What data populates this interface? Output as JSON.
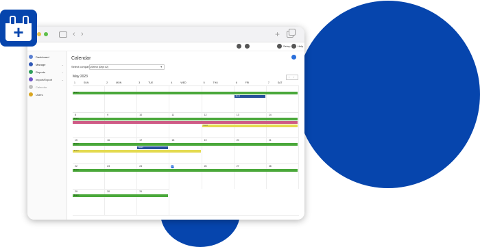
{
  "page": {
    "title": "Calendar",
    "select_label": "Select company",
    "select_value": "Select (Dept #2)",
    "month_label": "May 2023"
  },
  "topbar": {
    "setup_label": "Setup",
    "help_label": "Help"
  },
  "sidebar": {
    "items": [
      {
        "label": "Dashboard",
        "icon": "dashboard-icon",
        "color": "#5a7fd1",
        "has_chevron": false,
        "active": false
      },
      {
        "label": "Manage",
        "icon": "manage-icon",
        "color": "#2f58b6",
        "has_chevron": true,
        "active": false
      },
      {
        "label": "Reports",
        "icon": "reports-icon",
        "color": "#2e9f5a",
        "has_chevron": true,
        "active": false
      },
      {
        "label": "Import/Export",
        "icon": "import-export-icon",
        "color": "#6d53c7",
        "has_chevron": true,
        "active": false
      },
      {
        "label": "Calendar",
        "icon": "calendar-icon",
        "color": "#bfbfbf",
        "has_chevron": false,
        "active": true
      },
      {
        "label": "Users",
        "icon": "users-icon",
        "color": "#d9a520",
        "has_chevron": false,
        "active": false
      }
    ]
  },
  "weekdays": [
    {
      "num": "1",
      "name": "SUN"
    },
    {
      "num": "2",
      "name": "MON"
    },
    {
      "num": "3",
      "name": "TUE"
    },
    {
      "num": "4",
      "name": "WED"
    },
    {
      "num": "5",
      "name": "THU"
    },
    {
      "num": "6",
      "name": "FRI"
    },
    {
      "num": "7",
      "name": "SAT"
    }
  ],
  "weeks": [
    {
      "days": [
        "",
        "",
        "",
        "",
        "",
        "",
        ""
      ],
      "events": [
        {
          "color": "green",
          "start": 0,
          "span": 7,
          "row": 0,
          "label": "Event"
        },
        {
          "color": "navy",
          "start": 5,
          "span": 1,
          "row": 1,
          "label": "Event"
        }
      ]
    },
    {
      "days": [
        "8",
        "9",
        "10",
        "11",
        "12",
        "13",
        "14"
      ],
      "events": [
        {
          "color": "green",
          "start": 0,
          "span": 7,
          "row": 0,
          "label": "Event"
        },
        {
          "color": "pink",
          "start": 0,
          "span": 7,
          "row": 1,
          "label": ""
        },
        {
          "color": "yellow",
          "start": 4,
          "span": 3,
          "row": 2,
          "label": "Event"
        }
      ]
    },
    {
      "days": [
        "15",
        "16",
        "17",
        "18",
        "19",
        "20",
        "21"
      ],
      "events": [
        {
          "color": "green",
          "start": 0,
          "span": 7,
          "row": 0,
          "label": "Event"
        },
        {
          "color": "navy",
          "start": 2,
          "span": 1,
          "row": 1,
          "label": "Event"
        },
        {
          "color": "yellow",
          "start": 0,
          "span": 4,
          "row": 2,
          "label": "Event"
        }
      ]
    },
    {
      "days": [
        "22",
        "23",
        "24",
        "25",
        "26",
        "27",
        "28"
      ],
      "today_index": 3,
      "events": [
        {
          "color": "green",
          "start": 0,
          "span": 7,
          "row": 0,
          "label": "Event"
        }
      ]
    },
    {
      "days": [
        "29",
        "30",
        "31",
        "",
        "",
        "",
        ""
      ],
      "events": [
        {
          "color": "green",
          "start": 0,
          "span": 3,
          "row": 0,
          "label": "Event"
        }
      ]
    }
  ]
}
